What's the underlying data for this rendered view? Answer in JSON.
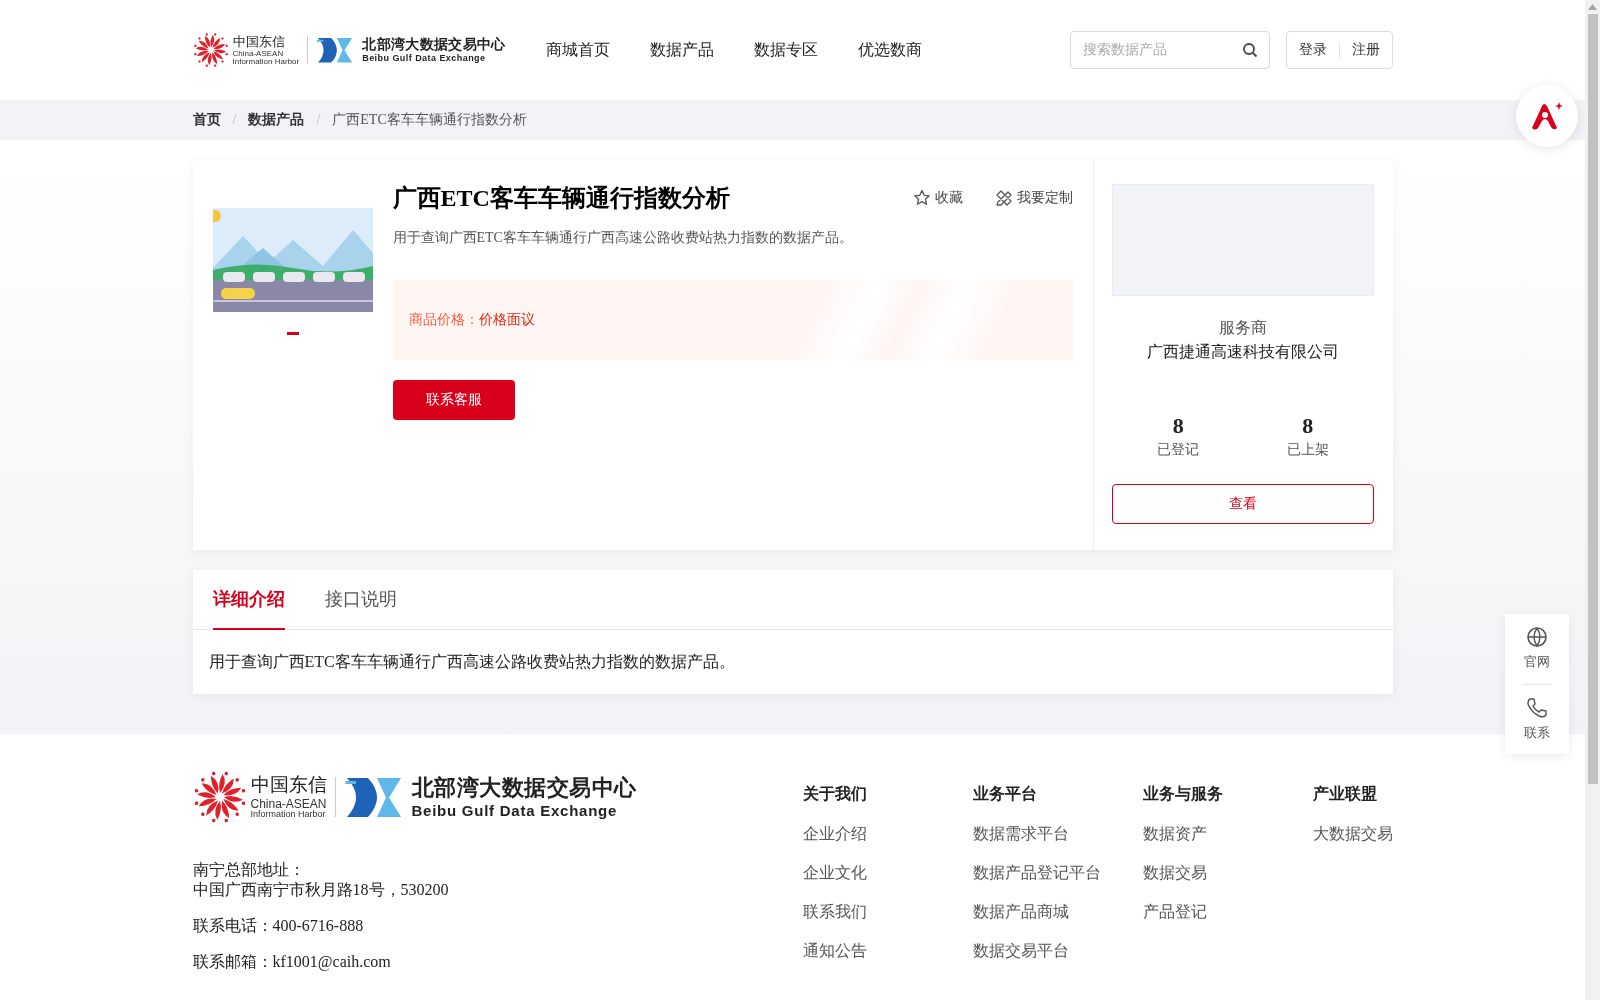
{
  "header": {
    "logo": {
      "cn": "中国东信",
      "en": "China-ASEAN",
      "en2": "Information Harbor",
      "exchange_cn": "北部湾大数据交易中心",
      "exchange_en": "Beibu Gulf Data Exchange"
    },
    "nav": [
      "商城首页",
      "数据产品",
      "数据专区",
      "优选数商"
    ],
    "search": {
      "placeholder": "搜索数据产品"
    },
    "auth": [
      "登录",
      "注册"
    ]
  },
  "breadcrumb": [
    {
      "label": "首页",
      "kind": "link"
    },
    {
      "label": "/",
      "kind": "separator"
    },
    {
      "label": "数据产品",
      "kind": "link"
    },
    {
      "label": "/",
      "kind": "separator"
    },
    {
      "label": "广西ETC客车车辆通行指数分析",
      "kind": "current"
    }
  ],
  "product": {
    "title": "广西ETC客车车辆通行指数分析",
    "description": "用于查询广西ETC客车车辆通行广西高速公路收费站热力指数的数据产品。",
    "actions": [
      {
        "kind": "favorite",
        "label": "收藏"
      },
      {
        "kind": "customize",
        "label": "我要定制"
      }
    ],
    "price_label": "商品价格：",
    "price": "价格面议",
    "contact_button": "联系客服"
  },
  "provider": {
    "heading": "服务商",
    "name": "广西捷通高速科技有限公司",
    "stats": [
      {
        "value": "8",
        "label": "已登记"
      },
      {
        "value": "8",
        "label": "已上架"
      }
    ],
    "button": "查看"
  },
  "tabs": [
    {
      "label": "详细介绍",
      "selected": true
    },
    {
      "label": "接口说明",
      "selected": false
    }
  ],
  "detail_text": "用于查询广西ETC客车车辆通行广西高速公路收费站热力指数的数据产品。",
  "floating": [
    {
      "kind": "globe",
      "label": "官网"
    },
    {
      "kind": "phone",
      "label": "联系"
    }
  ],
  "footer": {
    "logo": {
      "cn": "中国东信",
      "en": "China-ASEAN",
      "en2": "Information Harbor",
      "exchange_cn": "北部湾大数据交易中心",
      "exchange_en": "Beibu Gulf Data Exchange"
    },
    "address_label": "南宁总部地址：",
    "address": "中国广西南宁市秋月路18号，530200",
    "phone": "联系电话：400-6716-888",
    "email": "联系邮箱：kf1001@caih.com",
    "columns": [
      {
        "title": "关于我们",
        "links": [
          "企业介绍",
          "企业文化",
          "联系我们",
          "通知公告"
        ]
      },
      {
        "title": "业务平台",
        "links": [
          "数据需求平台",
          "数据产品登记平台",
          "数据产品商城",
          "数据交易平台"
        ]
      },
      {
        "title": "业务与服务",
        "links": [
          "数据资产",
          "数据交易",
          "产品登记"
        ]
      },
      {
        "title": "产业联盟",
        "links": [
          "大数据交易"
        ]
      }
    ]
  }
}
